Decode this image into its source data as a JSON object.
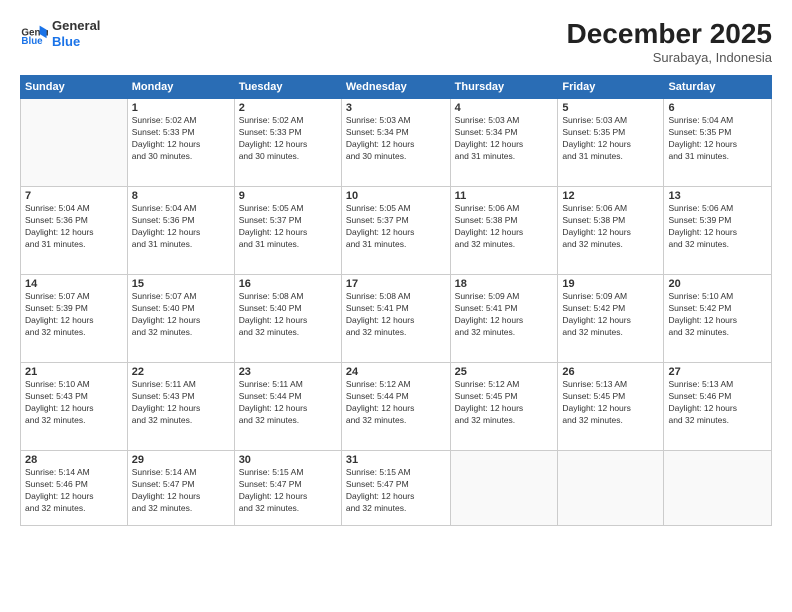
{
  "header": {
    "logo_line1": "General",
    "logo_line2": "Blue",
    "month": "December 2025",
    "location": "Surabaya, Indonesia"
  },
  "weekdays": [
    "Sunday",
    "Monday",
    "Tuesday",
    "Wednesday",
    "Thursday",
    "Friday",
    "Saturday"
  ],
  "weeks": [
    [
      {
        "day": "",
        "info": ""
      },
      {
        "day": "1",
        "info": "Sunrise: 5:02 AM\nSunset: 5:33 PM\nDaylight: 12 hours\nand 30 minutes."
      },
      {
        "day": "2",
        "info": "Sunrise: 5:02 AM\nSunset: 5:33 PM\nDaylight: 12 hours\nand 30 minutes."
      },
      {
        "day": "3",
        "info": "Sunrise: 5:03 AM\nSunset: 5:34 PM\nDaylight: 12 hours\nand 30 minutes."
      },
      {
        "day": "4",
        "info": "Sunrise: 5:03 AM\nSunset: 5:34 PM\nDaylight: 12 hours\nand 31 minutes."
      },
      {
        "day": "5",
        "info": "Sunrise: 5:03 AM\nSunset: 5:35 PM\nDaylight: 12 hours\nand 31 minutes."
      },
      {
        "day": "6",
        "info": "Sunrise: 5:04 AM\nSunset: 5:35 PM\nDaylight: 12 hours\nand 31 minutes."
      }
    ],
    [
      {
        "day": "7",
        "info": "Sunrise: 5:04 AM\nSunset: 5:36 PM\nDaylight: 12 hours\nand 31 minutes."
      },
      {
        "day": "8",
        "info": "Sunrise: 5:04 AM\nSunset: 5:36 PM\nDaylight: 12 hours\nand 31 minutes."
      },
      {
        "day": "9",
        "info": "Sunrise: 5:05 AM\nSunset: 5:37 PM\nDaylight: 12 hours\nand 31 minutes."
      },
      {
        "day": "10",
        "info": "Sunrise: 5:05 AM\nSunset: 5:37 PM\nDaylight: 12 hours\nand 31 minutes."
      },
      {
        "day": "11",
        "info": "Sunrise: 5:06 AM\nSunset: 5:38 PM\nDaylight: 12 hours\nand 32 minutes."
      },
      {
        "day": "12",
        "info": "Sunrise: 5:06 AM\nSunset: 5:38 PM\nDaylight: 12 hours\nand 32 minutes."
      },
      {
        "day": "13",
        "info": "Sunrise: 5:06 AM\nSunset: 5:39 PM\nDaylight: 12 hours\nand 32 minutes."
      }
    ],
    [
      {
        "day": "14",
        "info": "Sunrise: 5:07 AM\nSunset: 5:39 PM\nDaylight: 12 hours\nand 32 minutes."
      },
      {
        "day": "15",
        "info": "Sunrise: 5:07 AM\nSunset: 5:40 PM\nDaylight: 12 hours\nand 32 minutes."
      },
      {
        "day": "16",
        "info": "Sunrise: 5:08 AM\nSunset: 5:40 PM\nDaylight: 12 hours\nand 32 minutes."
      },
      {
        "day": "17",
        "info": "Sunrise: 5:08 AM\nSunset: 5:41 PM\nDaylight: 12 hours\nand 32 minutes."
      },
      {
        "day": "18",
        "info": "Sunrise: 5:09 AM\nSunset: 5:41 PM\nDaylight: 12 hours\nand 32 minutes."
      },
      {
        "day": "19",
        "info": "Sunrise: 5:09 AM\nSunset: 5:42 PM\nDaylight: 12 hours\nand 32 minutes."
      },
      {
        "day": "20",
        "info": "Sunrise: 5:10 AM\nSunset: 5:42 PM\nDaylight: 12 hours\nand 32 minutes."
      }
    ],
    [
      {
        "day": "21",
        "info": "Sunrise: 5:10 AM\nSunset: 5:43 PM\nDaylight: 12 hours\nand 32 minutes."
      },
      {
        "day": "22",
        "info": "Sunrise: 5:11 AM\nSunset: 5:43 PM\nDaylight: 12 hours\nand 32 minutes."
      },
      {
        "day": "23",
        "info": "Sunrise: 5:11 AM\nSunset: 5:44 PM\nDaylight: 12 hours\nand 32 minutes."
      },
      {
        "day": "24",
        "info": "Sunrise: 5:12 AM\nSunset: 5:44 PM\nDaylight: 12 hours\nand 32 minutes."
      },
      {
        "day": "25",
        "info": "Sunrise: 5:12 AM\nSunset: 5:45 PM\nDaylight: 12 hours\nand 32 minutes."
      },
      {
        "day": "26",
        "info": "Sunrise: 5:13 AM\nSunset: 5:45 PM\nDaylight: 12 hours\nand 32 minutes."
      },
      {
        "day": "27",
        "info": "Sunrise: 5:13 AM\nSunset: 5:46 PM\nDaylight: 12 hours\nand 32 minutes."
      }
    ],
    [
      {
        "day": "28",
        "info": "Sunrise: 5:14 AM\nSunset: 5:46 PM\nDaylight: 12 hours\nand 32 minutes."
      },
      {
        "day": "29",
        "info": "Sunrise: 5:14 AM\nSunset: 5:47 PM\nDaylight: 12 hours\nand 32 minutes."
      },
      {
        "day": "30",
        "info": "Sunrise: 5:15 AM\nSunset: 5:47 PM\nDaylight: 12 hours\nand 32 minutes."
      },
      {
        "day": "31",
        "info": "Sunrise: 5:15 AM\nSunset: 5:47 PM\nDaylight: 12 hours\nand 32 minutes."
      },
      {
        "day": "",
        "info": ""
      },
      {
        "day": "",
        "info": ""
      },
      {
        "day": "",
        "info": ""
      }
    ]
  ]
}
